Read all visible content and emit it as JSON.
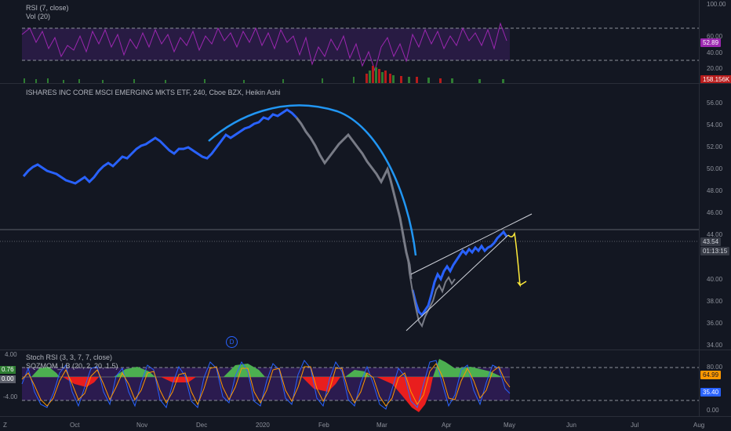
{
  "rsi_pane": {
    "title": "RSI (7, close)",
    "vol_title": "Vol (20)",
    "ticks": [
      "100.00",
      "60.00",
      "40.00",
      "20.00"
    ],
    "rsi_value": "52.89",
    "vol_value": "158.156K"
  },
  "main_pane": {
    "title": "ISHARES INC CORE MSCI EMERGING MKTS ETF, 240, Cboe BZX, Heikin Ashi",
    "ticks": [
      "56.00",
      "54.00",
      "52.00",
      "50.00",
      "48.00",
      "46.00",
      "44.00",
      "40.00",
      "38.00",
      "36.00",
      "34.00"
    ],
    "price_tag": "43.54",
    "countdown_tag": "01:13:15",
    "event_badge": "D"
  },
  "osc_pane": {
    "title1": "Stoch RSI (3, 3, 7, 7, close)",
    "title2": "SQZMOM_LB (20, 2, 20, 1.5)",
    "left_ticks": [
      "4.00",
      "-4.00"
    ],
    "left_value1": "0.76",
    "left_value2": "0.00",
    "right_ticks": [
      "80.00",
      "0.00"
    ],
    "k_value": "64.99",
    "d_value": "35.40"
  },
  "time_axis": {
    "months": [
      "Oct",
      "Nov",
      "Dec",
      "2020",
      "Feb",
      "Mar",
      "Apr",
      "May",
      "Jun",
      "Jul",
      "Aug"
    ],
    "corner_button": "Z"
  },
  "colors": {
    "background": "#131722",
    "up": "#2962ff",
    "down": "#787b86",
    "rsi": "#9c27b0",
    "arc": "#2196f3",
    "arrow": "#ffeb3b",
    "sqz_pos": "#4caf50",
    "sqz_neg": "#e91e1e",
    "band": "#3c1e6e"
  }
}
